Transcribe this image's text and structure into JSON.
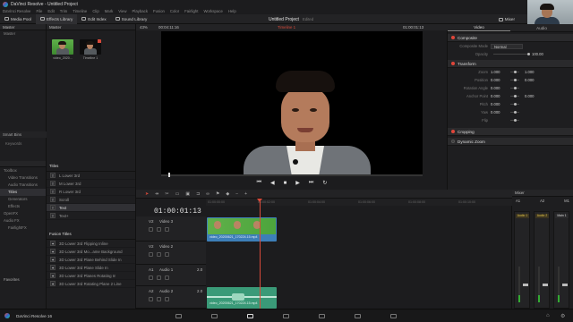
{
  "app": {
    "title": "DaVinci Resolve - Untitled Project",
    "brand": "DaVinci Resolve 16"
  },
  "menu": [
    "DaVinci Resolve",
    "File",
    "Edit",
    "Trim",
    "Timeline",
    "Clip",
    "Mark",
    "View",
    "Playback",
    "Fusion",
    "Color",
    "Fairlight",
    "Workspace",
    "Help"
  ],
  "toolbar": {
    "media_pool": "Media Pool",
    "effects_library": "Effects Library",
    "edit_index": "Edit Index",
    "sound_library": "Sound Library",
    "project_title": "Untitled Project",
    "project_status": "Edited",
    "mixer": "Mixer",
    "metadata": "Metadata"
  },
  "left_panel": {
    "header": "Master",
    "bins": [
      "Master"
    ],
    "smart_bins": "Smart Bins",
    "keywords": "Keywords"
  },
  "media_pool": {
    "clips": [
      {
        "label": "video_2020..."
      },
      {
        "label": "Timeline 1"
      }
    ]
  },
  "viewer": {
    "zoom": "43%",
    "timecode_left": "00:04:11:16",
    "timeline_name": "Timeline 1",
    "timecode_right": "01:00:01:13"
  },
  "inspector": {
    "tabs": [
      "Video",
      "Audio"
    ],
    "composite": {
      "title": "Composite",
      "mode_label": "Composite Mode",
      "mode_value": "Normal",
      "opacity_label": "Opacity",
      "opacity_value": "100.00"
    },
    "transform": {
      "title": "Transform",
      "props": [
        {
          "label": "Zoom",
          "x": "1.000",
          "y": "1.000"
        },
        {
          "label": "Position",
          "x": "0.000",
          "y": "0.000"
        },
        {
          "label": "Rotation Angle",
          "x": "0.000",
          "y": ""
        },
        {
          "label": "Anchor Point",
          "x": "0.000",
          "y": "0.000"
        },
        {
          "label": "Pitch",
          "x": "0.000",
          "y": ""
        },
        {
          "label": "Yaw",
          "x": "0.000",
          "y": ""
        },
        {
          "label": "Flip",
          "x": "",
          "y": ""
        }
      ]
    },
    "cropping": "Cropping",
    "dynamic_zoom": "Dynamic Zoom"
  },
  "toolbox": {
    "items": [
      {
        "label": "Toolbox",
        "level": "top"
      },
      {
        "label": "Video Transitions",
        "level": "child"
      },
      {
        "label": "Audio Transitions",
        "level": "child"
      },
      {
        "label": "Titles",
        "level": "child",
        "selected": true
      },
      {
        "label": "Generators",
        "level": "child"
      },
      {
        "label": "Effects",
        "level": "child"
      },
      {
        "label": "OpenFX",
        "level": "top"
      },
      {
        "label": "Audio FX",
        "level": "top"
      },
      {
        "label": "FairlightFX",
        "level": "child"
      }
    ],
    "favorites": "Favorites"
  },
  "titles": {
    "header": "Titles",
    "items": [
      "L Lower 3rd",
      "M Lower 3rd",
      "R Lower 3rd",
      "Scroll",
      "Text",
      "Text+"
    ],
    "fusion_header": "Fusion Titles",
    "fusion_items": [
      "3D Lower 3rd Flipping Inline",
      "3D Lower 3rd Mo...ame Background",
      "3D Lower 3rd Plane Behind Slide In",
      "3D Lower 3rd Plane Slide In",
      "3D Lower 3rd Planes Rotating In",
      "3D Lower 3rd Rotating Plane 2 Line"
    ]
  },
  "timeline": {
    "timecode": "01:00:01:13",
    "ruler": [
      "01:00:00:00",
      "01:00:02:00",
      "01:00:04:00",
      "01:00:06:00",
      "01:00:08:00",
      "01:00:10:00"
    ],
    "tracks": [
      {
        "id": "V2",
        "name": "Video 3"
      },
      {
        "id": "V2",
        "name": "Video 2"
      },
      {
        "id": "A1",
        "name": "Audio 1",
        "level": "2.0"
      },
      {
        "id": "A2",
        "name": "Audio 2",
        "level": "2.0"
      }
    ],
    "video_clip_label": "video_20200621_170224.15.mp4",
    "audio_clip_label": "video_20200621_170224.15.mp4"
  },
  "mixer": {
    "title": "Mixer",
    "channels": [
      "A1",
      "A2",
      "M1"
    ],
    "channel_names": [
      "Audio 1",
      "Audio 2",
      "Main 1"
    ]
  },
  "colors": {
    "accent": "#d84a3a",
    "video_clip": "#3d7fb8",
    "audio_clip": "#3a9a78"
  }
}
